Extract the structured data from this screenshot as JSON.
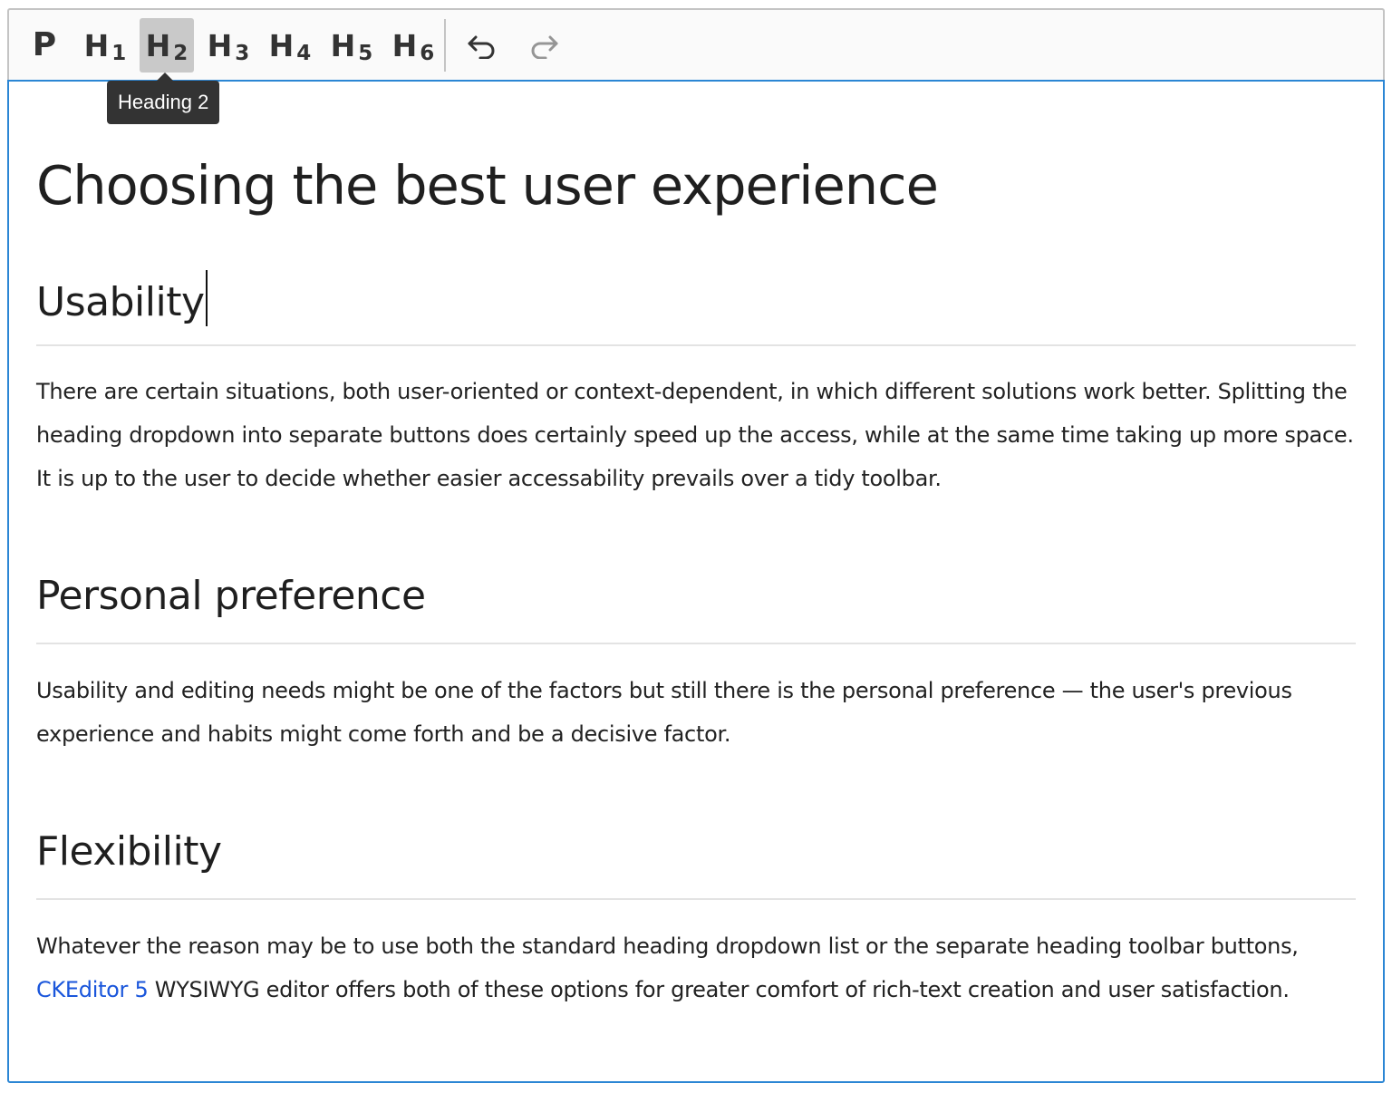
{
  "toolbar": {
    "paragraph": {
      "label": "P"
    },
    "headings": [
      {
        "h": "H",
        "num": "1"
      },
      {
        "h": "H",
        "num": "2"
      },
      {
        "h": "H",
        "num": "3"
      },
      {
        "h": "H",
        "num": "4"
      },
      {
        "h": "H",
        "num": "5"
      },
      {
        "h": "H",
        "num": "6"
      }
    ],
    "active_heading": 2,
    "undo_icon": "undo-icon",
    "redo_icon": "redo-icon"
  },
  "tooltip": {
    "text": "Heading 2"
  },
  "document": {
    "title": "Choosing the best user experience",
    "sections": [
      {
        "heading": "Usability",
        "paragraphs": [
          "There are certain situations, both user-oriented or context-dependent, in which different solutions work better. Splitting the heading dropdown into separate buttons does certainly speed up the access, while at the same time taking up more space. It is up to the user to decide whether easier accessability prevails over a tidy toolbar."
        ]
      },
      {
        "heading": "Personal preference",
        "paragraphs": [
          "Usability and editing needs might be one of the factors but still there is the personal preference — the user's previous experience and habits might come forth and be a decisive factor."
        ]
      },
      {
        "heading": "Flexibility",
        "paragraph_before_link": "Whatever the reason may be to use both the standard heading dropdown list or the separate heading toolbar buttons, ",
        "link_text": "CKEditor 5",
        "paragraph_after_link": " WYSIWYG editor offers both of these options for greater comfort of rich-text creation and user satisfaction."
      }
    ]
  },
  "colors": {
    "focus_border": "#2b86d4",
    "link": "#1a56db",
    "tooltip_bg": "#333333",
    "active_button_bg": "#c9c9c9"
  }
}
